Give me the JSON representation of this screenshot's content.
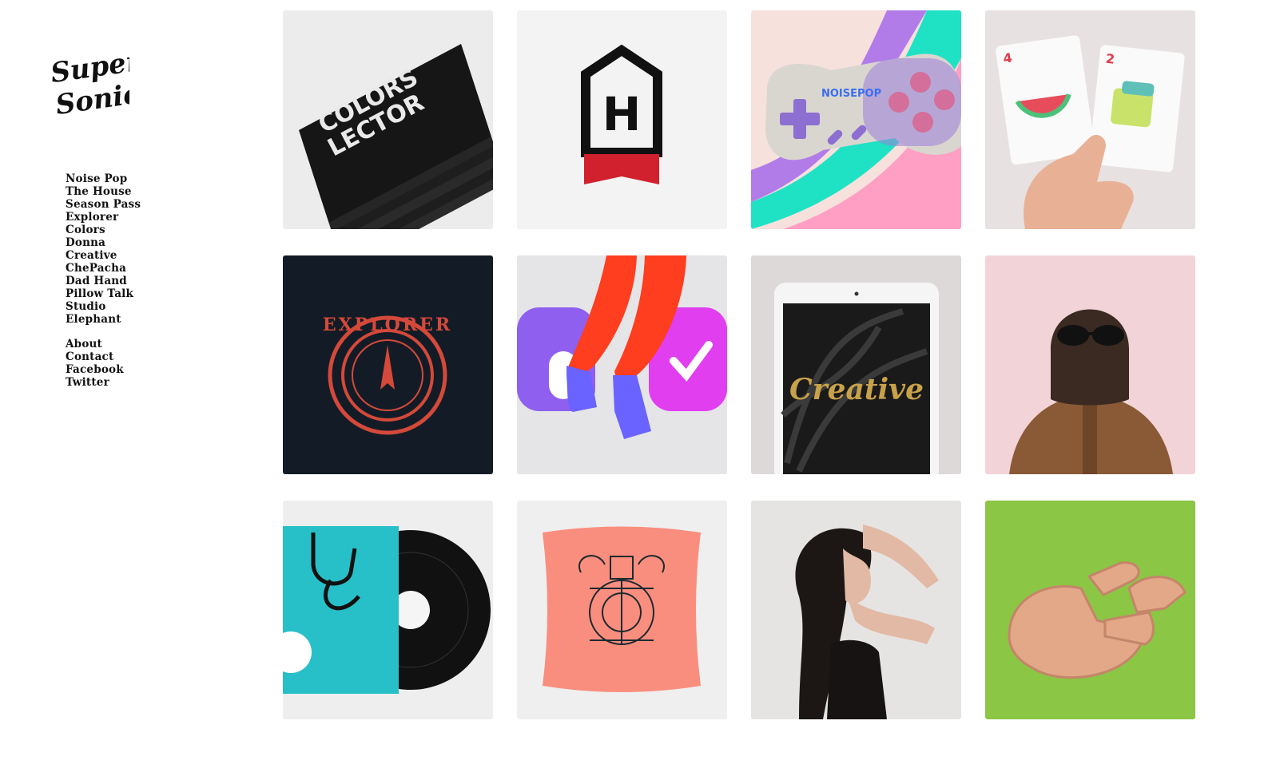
{
  "brand": {
    "logo_line1": "Super",
    "logo_line2": "Sonic"
  },
  "nav": {
    "projects": [
      {
        "label": "Noise Pop"
      },
      {
        "label": "The House"
      },
      {
        "label": "Season Pass"
      },
      {
        "label": "Explorer"
      },
      {
        "label": "Colors"
      },
      {
        "label": "Donna"
      },
      {
        "label": "Creative"
      },
      {
        "label": "ChePacha"
      },
      {
        "label": "Dad Hand"
      },
      {
        "label": "Pillow Talk"
      },
      {
        "label": "Studio"
      },
      {
        "label": "Elephant"
      }
    ],
    "links": [
      {
        "label": "About"
      },
      {
        "label": "Contact"
      },
      {
        "label": "Facebook"
      },
      {
        "label": "Twitter"
      }
    ]
  },
  "tiles": {
    "colors_magazine": {
      "text1": "COLORS",
      "text2": "LECTOR"
    },
    "house_logo": {
      "letter": "H"
    },
    "noisepop_controller": {
      "text": "NOISEPOP"
    },
    "season_pass_cards": {
      "card1": "4",
      "card2": "2"
    },
    "explorer_badge": {
      "text": "EXPLORER"
    },
    "donna_legs": {},
    "creative_tablet": {
      "text": "Creative"
    },
    "chepacha_portrait": {},
    "dad_hand_vinyl": {},
    "pillow_talk": {},
    "studio_portrait": {},
    "elephant_wood": {}
  },
  "colors": {
    "text": "#111111",
    "background": "#ffffff"
  }
}
